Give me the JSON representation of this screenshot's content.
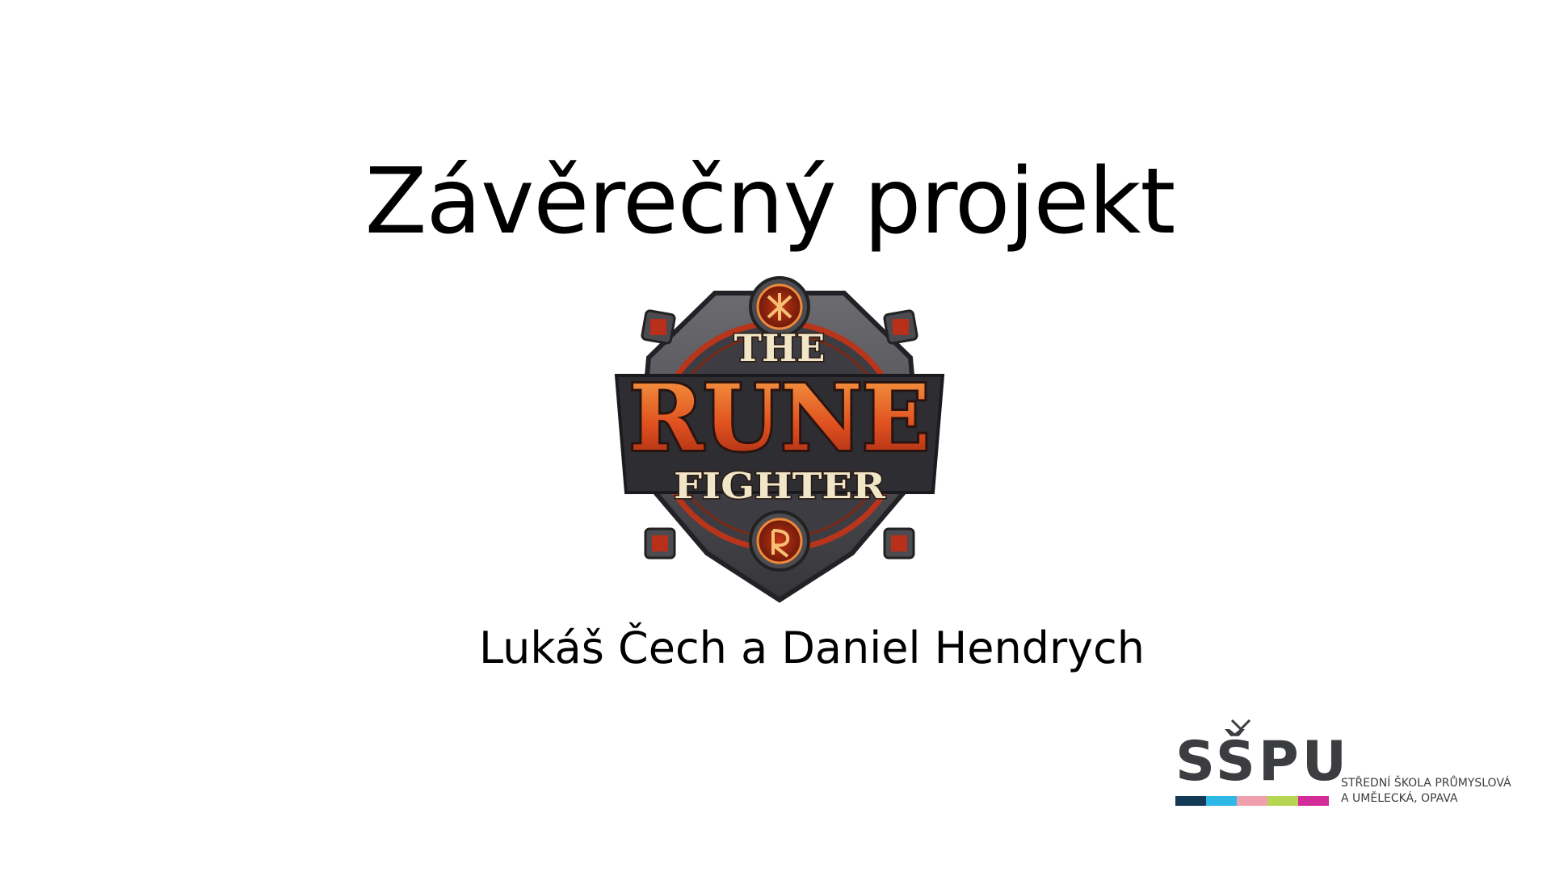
{
  "slide": {
    "title": "Závěrečný projekt",
    "authors": "Lukáš Čech a Daniel Hendrych"
  },
  "game_logo": {
    "line1": "THE",
    "line2": "RUNE",
    "line3": "FIGHTER",
    "colors": {
      "stone": "#4a4a4f",
      "rune_red": "#d9441c",
      "text_cream": "#f1e6c8",
      "text_orange": "#e8632a"
    }
  },
  "school": {
    "acronym": "SŠPU",
    "name_line1": "STŘEDNÍ ŠKOLA PRŮMYSLOVÁ",
    "name_line2": "A UMĚLECKÁ, OPAVA",
    "bar_colors": [
      "#123a57",
      "#2db8e6",
      "#f0a0ad",
      "#b6d553",
      "#d42c98"
    ]
  }
}
